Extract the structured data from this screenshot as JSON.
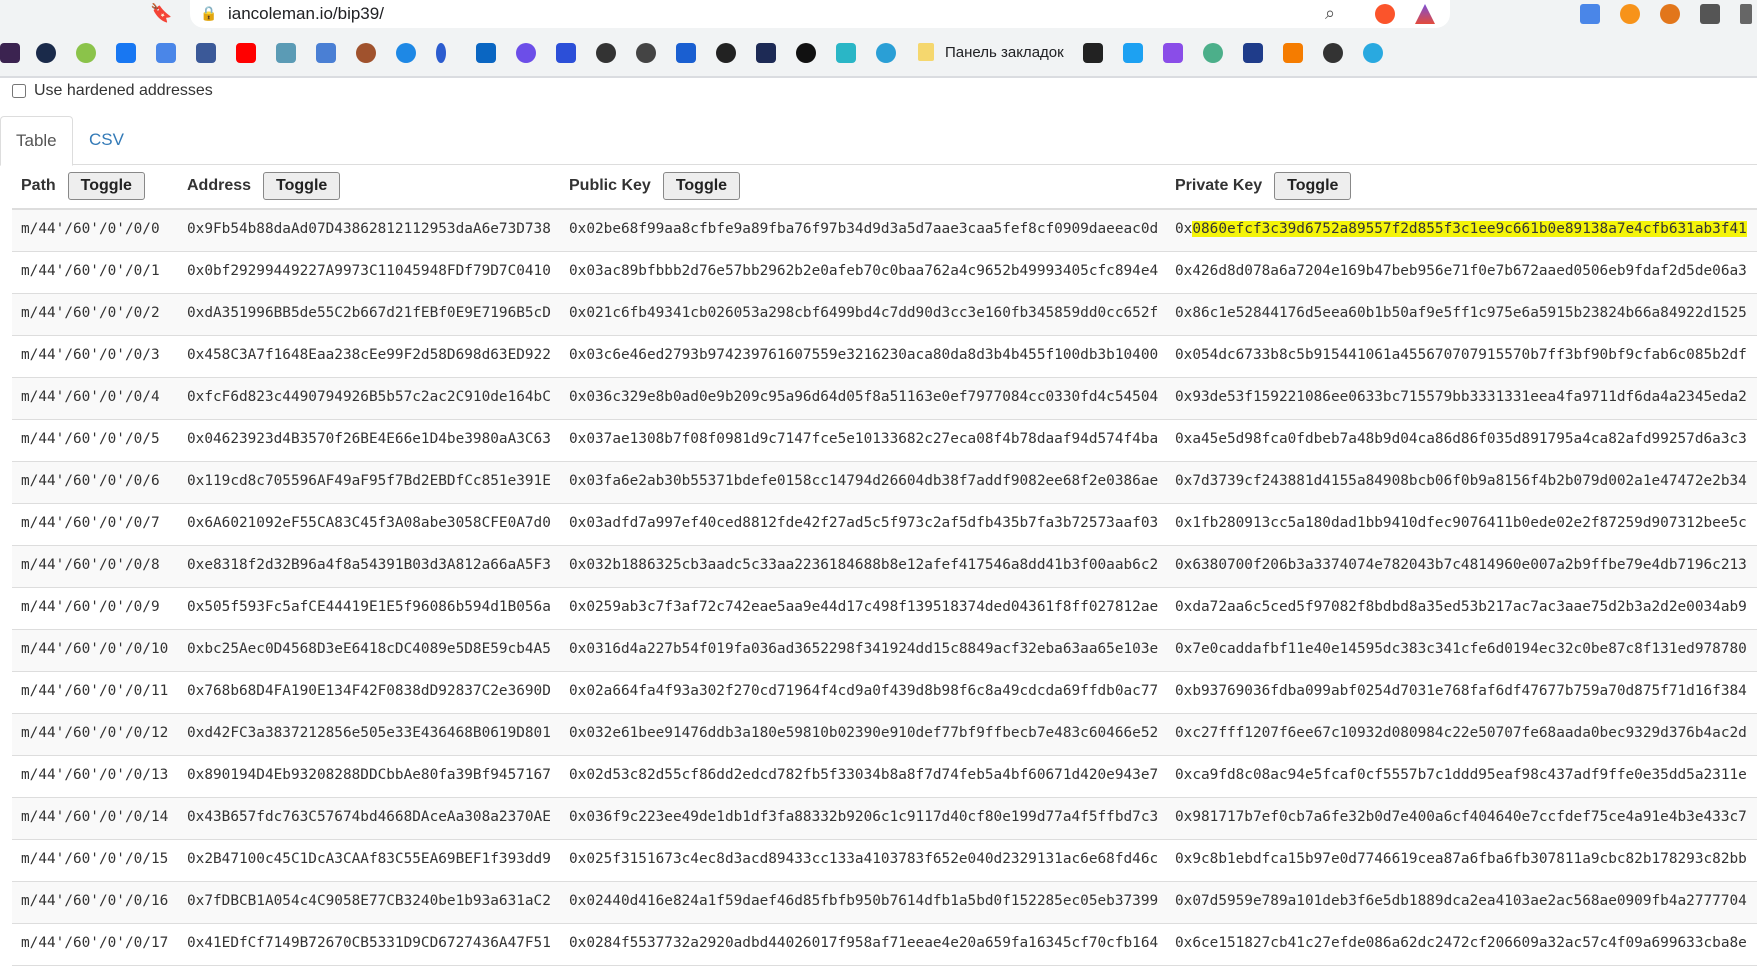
{
  "browser": {
    "url": "iancoleman.io/bip39/",
    "bookmarks_label": "Панель закладок"
  },
  "options": {
    "hardened_label": "Use hardened addresses",
    "hardened_checked": false
  },
  "tabs": [
    {
      "label": "Table",
      "active": true
    },
    {
      "label": "CSV",
      "active": false
    }
  ],
  "headers": {
    "path": "Path",
    "address": "Address",
    "public_key": "Public Key",
    "private_key": "Private Key",
    "toggle": "Toggle"
  },
  "highlight_color": "#f4f40a",
  "rows": [
    {
      "path": "m/44'/60'/0'/0/0",
      "address": "0x9Fb54b88daAd07D43862812112953daA6e73D738",
      "public_key": "0x02be68f99aa8cfbfe9a89fba76f97b34d9d3a5d7aae3caa5fef8cf0909daeeac0d",
      "private_key": "0x0860efcf3c39d6752a89557f2d855f3c1ee9c661b0e89138a7e4cfb631ab3f41",
      "highlighted": true
    },
    {
      "path": "m/44'/60'/0'/0/1",
      "address": "0x0bf29299449227A9973C11045948FDf79D7C0410",
      "public_key": "0x03ac89bfbbb2d76e57bb2962b2e0afeb70c0baa762a4c9652b49993405cfc894e4",
      "private_key": "0x426d8d078a6a7204e169b47beb956e71f0e7b672aaed0506eb9fdaf2d5de06a3"
    },
    {
      "path": "m/44'/60'/0'/0/2",
      "address": "0xdA351996BB5de55C2b667d21fEBf0E9E7196B5cD",
      "public_key": "0x021c6fb49341cb026053a298cbf6499bd4c7dd90d3cc3e160fb345859dd0cc652f",
      "private_key": "0x86c1e52844176d5eea60b1b50af9e5ff1c975e6a5915b23824b66a84922d1525"
    },
    {
      "path": "m/44'/60'/0'/0/3",
      "address": "0x458C3A7f1648Eaa238cEe99F2d58D698d63ED922",
      "public_key": "0x03c6e46ed2793b974239761607559e3216230aca80da8d3b4b455f100db3b10400",
      "private_key": "0x054dc6733b8c5b915441061a455670707915570b7ff3bf90bf9cfab6c085b2df"
    },
    {
      "path": "m/44'/60'/0'/0/4",
      "address": "0xfcF6d823c4490794926B5b57c2ac2C910de164bC",
      "public_key": "0x036c329e8b0ad0e9b209c95a96d64d05f8a51163e0ef7977084cc0330fd4c54504",
      "private_key": "0x93de53f159221086ee0633bc715579bb3331331eea4fa9711df6da4a2345eda2"
    },
    {
      "path": "m/44'/60'/0'/0/5",
      "address": "0x04623923d4B3570f26BE4E66e1D4be3980aA3C63",
      "public_key": "0x037ae1308b7f08f0981d9c7147fce5e10133682c27eca08f4b78daaf94d574f4ba",
      "private_key": "0xa45e5d98fca0fdbeb7a48b9d04ca86d86f035d891795a4ca82afd99257d6a3c3"
    },
    {
      "path": "m/44'/60'/0'/0/6",
      "address": "0x119cd8c705596AF49aF95f7Bd2EBDfCc851e391E",
      "public_key": "0x03fa6e2ab30b55371bdefe0158cc14794d26604db38f7addf9082ee68f2e0386ae",
      "private_key": "0x7d3739cf243881d4155a84908bcb06f0b9a8156f4b2b079d002a1e47472e2b34"
    },
    {
      "path": "m/44'/60'/0'/0/7",
      "address": "0x6A6021092eF55CA83C45f3A08abe3058CFE0A7d0",
      "public_key": "0x03adfd7a997ef40ced8812fde42f27ad5c5f973c2af5dfb435b7fa3b72573aaf03",
      "private_key": "0x1fb280913cc5a180dad1bb9410dfec9076411b0ede02e2f87259d907312bee5c"
    },
    {
      "path": "m/44'/60'/0'/0/8",
      "address": "0xe8318f2d32B96a4f8a54391B03d3A812a66aA5F3",
      "public_key": "0x032b1886325cb3aadc5c33aa2236184688b8e12afef417546a8dd41b3f00aab6c2",
      "private_key": "0x6380700f206b3a3374074e782043b7c4814960e007a2b9ffbe79e4db7196c213"
    },
    {
      "path": "m/44'/60'/0'/0/9",
      "address": "0x505f593Fc5afCE44419E1E5f96086b594d1B056a",
      "public_key": "0x0259ab3c7f3af72c742eae5aa9e44d17c498f139518374ded04361f8ff027812ae",
      "private_key": "0xda72aa6c5ced5f97082f8bdbd8a35ed53b217ac7ac3aae75d2b3a2d2e0034ab9"
    },
    {
      "path": "m/44'/60'/0'/0/10",
      "address": "0xbc25Aec0D4568D3eE6418cDC4089e5D8E59cb4A5",
      "public_key": "0x0316d4a227b54f019fa036ad3652298f341924dd15c8849acf32eba63aa65e103e",
      "private_key": "0x7e0caddafbf11e40e14595dc383c341cfe6d0194ec32c0be87c8f131ed978780"
    },
    {
      "path": "m/44'/60'/0'/0/11",
      "address": "0x768b68D4FA190E134F42F0838dD92837C2e3690D",
      "public_key": "0x02a664fa4f93a302f270cd71964f4cd9a0f439d8b98f6c8a49cdcda69ffdb0ac77",
      "private_key": "0xb93769036fdba099abf0254d7031e768faf6df47677b759a70d875f71d16f384"
    },
    {
      "path": "m/44'/60'/0'/0/12",
      "address": "0xd42FC3a3837212856e505e33E436468B0619D801",
      "public_key": "0x032e61bee91476ddb3a180e59810b02390e910def77bf9ffbecb7e483c60466e52",
      "private_key": "0xc27fff1207f6ee67c10932d080984c22e50707fe68aada0bec9329d376b4ac2d"
    },
    {
      "path": "m/44'/60'/0'/0/13",
      "address": "0x890194D4Eb93208288DDCbbAe80fa39Bf9457167",
      "public_key": "0x02d53c82d55cf86dd2edcd782fb5f33034b8a8f7d74feb5a4bf60671d420e943e7",
      "private_key": "0xca9fd8c08ac94e5fcaf0cf5557b7c1ddd95eaf98c437adf9ffe0e35dd5a2311e"
    },
    {
      "path": "m/44'/60'/0'/0/14",
      "address": "0x43B657fdc763C57674bd4668DAceAa308a2370AE",
      "public_key": "0x036f9c223ee49de1db1df3fa88332b9206c1c9117d40cf80e199d77a4f5ffbd7c3",
      "private_key": "0x981717b7ef0cb7a6fe32b0d7e400a6cf404640e7ccfdef75ce4a91e4b3e433c7"
    },
    {
      "path": "m/44'/60'/0'/0/15",
      "address": "0x2B47100c45C1DcA3CAAf83C55EA69BEF1f393dd9",
      "public_key": "0x025f3151673c4ec8d3acd89433cc133a4103783f652e040d2329131ac6e68fd46c",
      "private_key": "0x9c8b1ebdfca15b97e0d7746619cea87a6fba6fb307811a9cbc82b178293c82bb"
    },
    {
      "path": "m/44'/60'/0'/0/16",
      "address": "0x7fDBCB1A054c4C9058E77CB3240be1b93a631aC2",
      "public_key": "0x02440d416e824a1f59daef46d85fbfb950b7614dfb1a5bd0f152285ec05eb37399",
      "private_key": "0x07d5959e789a101deb3f6e5db1889dca2ea4103ae2ac568ae0909fb4a2777704"
    },
    {
      "path": "m/44'/60'/0'/0/17",
      "address": "0x41EDfCf7149B72670CB5331D9CD6727436A47F51",
      "public_key": "0x0284f5537732a2920adbd44026017f958af71eeae4e20a659fa16345cf70cfb164",
      "private_key": "0x6ce151827cb41c27efde086a62dc2472cf206609a32ac57c4f09a699633cba8e"
    }
  ]
}
